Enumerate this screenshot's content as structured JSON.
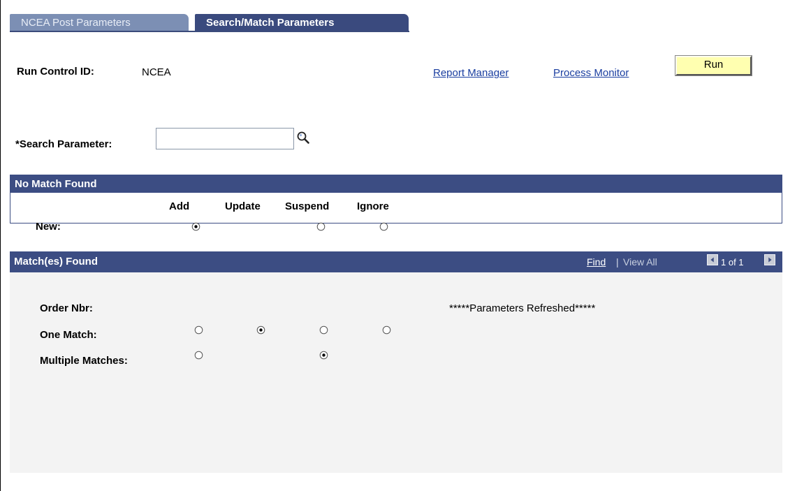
{
  "tabs": [
    {
      "label": "NCEA Post Parameters",
      "active": false
    },
    {
      "label": "Search/Match Parameters",
      "active": true
    }
  ],
  "run_control": {
    "label": "Run Control ID:",
    "value": "NCEA"
  },
  "links": {
    "report_manager": "Report Manager",
    "process_monitor": "Process Monitor"
  },
  "run_button": "Run",
  "search_parameter": {
    "label": "*Search Parameter:",
    "value": "",
    "lookup_icon": "magnifier-icon"
  },
  "no_match": {
    "title": "No Match Found",
    "columns": [
      "Add",
      "Update",
      "Suspend",
      "Ignore"
    ],
    "rows": [
      {
        "label": "New:",
        "options": [
          "selected",
          null,
          "unselected",
          "unselected"
        ]
      }
    ]
  },
  "matches": {
    "title": "Match(es) Found",
    "nav": {
      "find": "Find",
      "separator": "|",
      "view_all": "View All",
      "count": "1 of 1",
      "first_icon": "arrow-left-icon",
      "last_icon": "arrow-right-icon"
    },
    "order_nbr_label": "Order Nbr:",
    "status_message": "*****Parameters Refreshed*****",
    "rows": [
      {
        "label": "One Match:",
        "options": [
          "unselected",
          "selected",
          "unselected",
          "unselected"
        ]
      },
      {
        "label": "Multiple Matches:",
        "options": [
          "unselected",
          null,
          "selected",
          null
        ]
      }
    ]
  },
  "colors": {
    "header_blue": "#3c4d83",
    "tab_inactive": "#7c8fb4",
    "run_button": "#ffffb0",
    "link": "#1a3ea0"
  }
}
